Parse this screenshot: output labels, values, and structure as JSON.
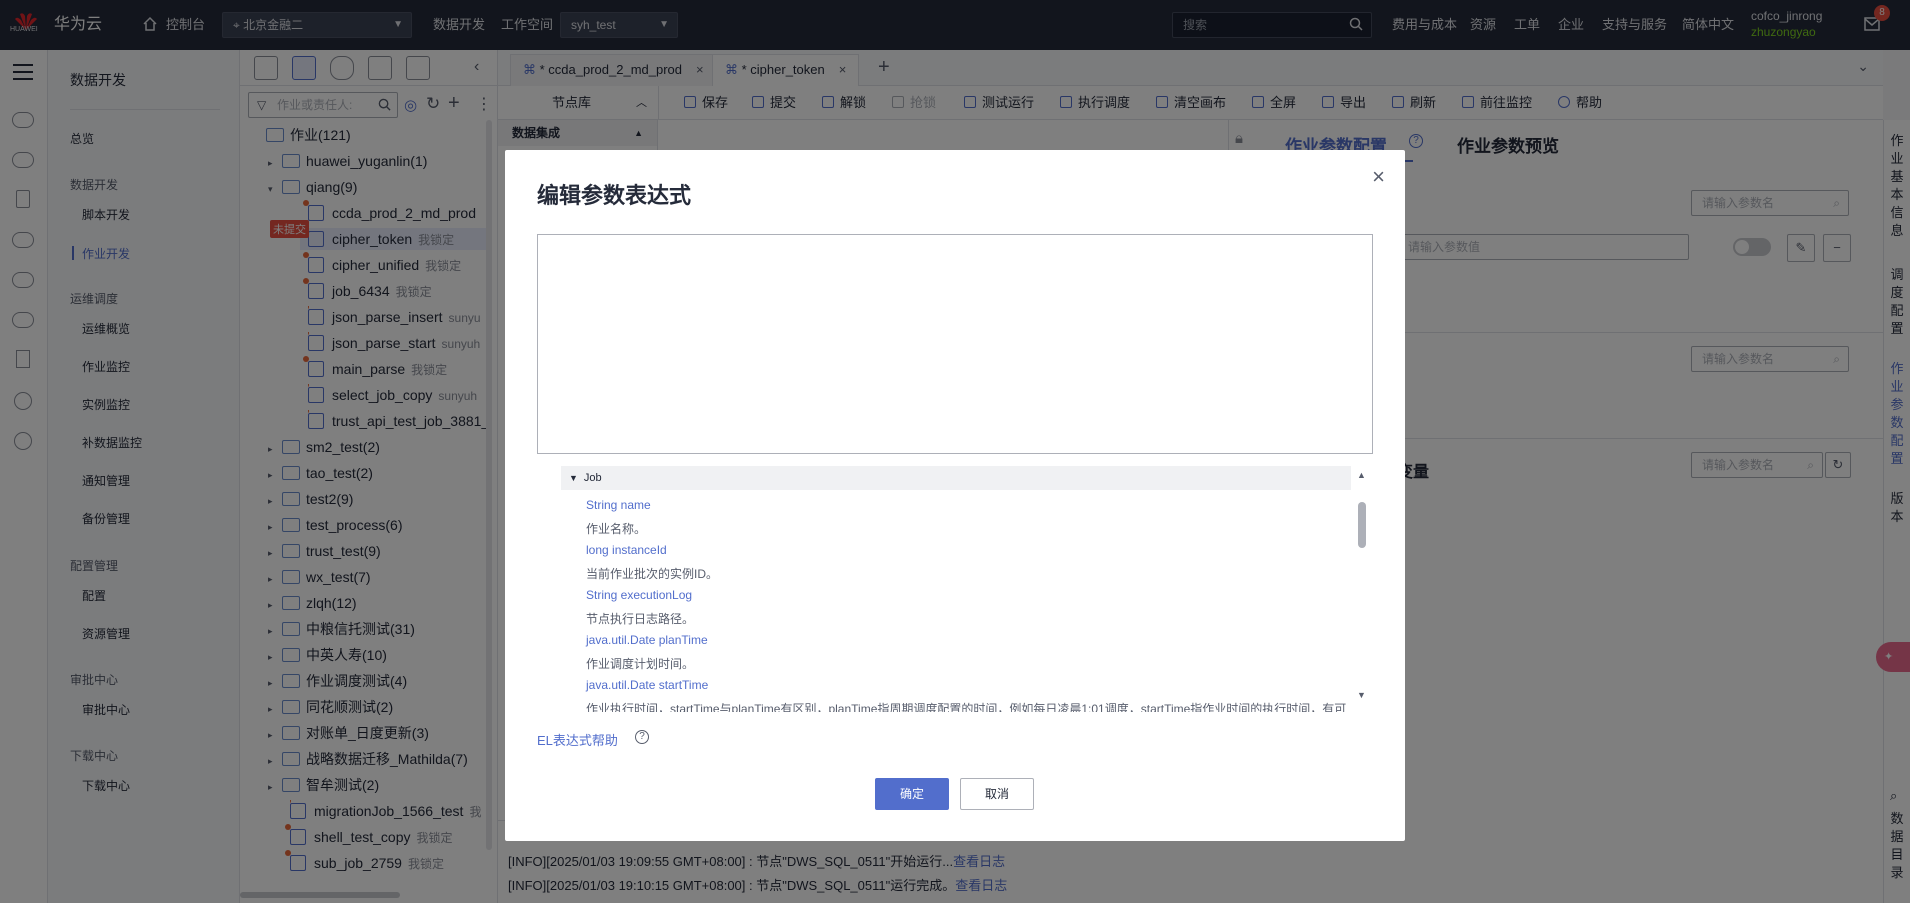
{
  "topbar": {
    "brand": "华为云",
    "brand_sub": "HUAWEI",
    "console": "控制台",
    "region": "北京金融二",
    "data_dev": "数据开发",
    "workspace_label": "工作空间",
    "workspace_value": "syh_test",
    "search_placeholder": "搜索",
    "links": [
      "费用与成本",
      "资源",
      "工单",
      "企业",
      "支持与服务",
      "简体中文"
    ],
    "user_line1": "cofco_jinrong",
    "user_line2": "zhuzongyao",
    "notif_count": "8"
  },
  "nav": {
    "title": "数据开发",
    "overview": "总览",
    "sec_dev": "数据开发",
    "script_dev": "脚本开发",
    "job_dev": "作业开发",
    "sec_ops": "运维调度",
    "ops_overview": "运维概览",
    "job_monitor": "作业监控",
    "instance_monitor": "实例监控",
    "backfill_monitor": "补数据监控",
    "notify_mgmt": "通知管理",
    "backup_mgmt": "备份管理",
    "sec_config": "配置管理",
    "config": "配置",
    "resource_mgmt": "资源管理",
    "sec_approval": "审批中心",
    "approval_center": "审批中心",
    "sec_download": "下载中心",
    "download_center": "下载中心"
  },
  "tree": {
    "search_placeholder": "作业或责任人:",
    "unsubmitted_tag": "未提交",
    "root": "作业(121)",
    "rows": [
      {
        "label": "huawei_yuganlin(1)",
        "meta": ""
      },
      {
        "label": "qiang(9)",
        "meta": ""
      },
      {
        "label": "ccda_prod_2_md_prod",
        "meta": ""
      },
      {
        "label": "cipher_token",
        "meta": "我锁定"
      },
      {
        "label": "cipher_unified",
        "meta": "我锁定"
      },
      {
        "label": "job_6434",
        "meta": "我锁定"
      },
      {
        "label": "json_parse_insert",
        "meta": "sunyu"
      },
      {
        "label": "json_parse_start",
        "meta": "sunyuh"
      },
      {
        "label": "main_parse",
        "meta": "我锁定"
      },
      {
        "label": "select_job_copy",
        "meta": "sunyuh"
      },
      {
        "label": "trust_api_test_job_3881_",
        "meta": ""
      },
      {
        "label": "sm2_test(2)",
        "meta": ""
      },
      {
        "label": "tao_test(2)",
        "meta": ""
      },
      {
        "label": "test2(9)",
        "meta": ""
      },
      {
        "label": "test_process(6)",
        "meta": ""
      },
      {
        "label": "trust_test(9)",
        "meta": ""
      },
      {
        "label": "wx_test(7)",
        "meta": ""
      },
      {
        "label": "zlqh(12)",
        "meta": ""
      },
      {
        "label": "中粮信托测试(31)",
        "meta": ""
      },
      {
        "label": "中英人寿(10)",
        "meta": ""
      },
      {
        "label": "作业调度测试(4)",
        "meta": ""
      },
      {
        "label": "同花顺测试(2)",
        "meta": ""
      },
      {
        "label": "对账单_日度更新(3)",
        "meta": ""
      },
      {
        "label": "战略数据迁移_Mathilda(7)",
        "meta": ""
      },
      {
        "label": "智牟测试(2)",
        "meta": ""
      },
      {
        "label": "migrationJob_1566_test",
        "meta": "我"
      },
      {
        "label": "shell_test_copy",
        "meta": "我锁定"
      },
      {
        "label": "sub_job_2759",
        "meta": "我锁定"
      }
    ]
  },
  "tabs": {
    "tab1": "* ccda_prod_2_md_prod",
    "tab2": "* cipher_token",
    "add": "+"
  },
  "toolbar": {
    "node_lib": "节点库",
    "save": "保存",
    "submit": "提交",
    "unlock": "解锁",
    "grab_lock": "抢锁",
    "test_run": "测试运行",
    "exec_schedule": "执行调度",
    "clear_canvas": "清空画布",
    "fullscreen": "全屏",
    "export": "导出",
    "refresh": "刷新",
    "goto_monitor": "前往监控",
    "help": "帮助"
  },
  "nodelib": {
    "group": "数据集成"
  },
  "right": {
    "tab_config": "作业参数配置",
    "tab_preview": "作业参数预览",
    "param_name_placeholder": "请输入参数名",
    "param_value_placeholder": "请输入参数值",
    "variables": "变量"
  },
  "vtabs": {
    "basic": "作业基本信息",
    "schedule": "调度配置",
    "params": "作业参数配置",
    "version": "版本",
    "catalog": "数据目录"
  },
  "log": {
    "line1_text": "[INFO][2025/01/03 19:09:55 GMT+08:00] : 节点\"DWS_SQL_0511\"开始运行...",
    "line1_link": "查看日志",
    "line2_text": "[INFO][2025/01/03 19:10:15 GMT+08:00] : 节点\"DWS_SQL_0511\"运行完成。",
    "line2_link": "查看日志"
  },
  "modal": {
    "title": "编辑参数表达式",
    "close": "×",
    "ref_group": "Job",
    "ref_items": [
      {
        "sig": "String name",
        "desc": "作业名称。"
      },
      {
        "sig": "long instanceId",
        "desc": "当前作业批次的实例ID。"
      },
      {
        "sig": "String executionLog",
        "desc": "节点执行日志路径。"
      },
      {
        "sig": "java.util.Date planTime",
        "desc": "作业调度计划时间。"
      },
      {
        "sig": "java.util.Date startTime",
        "desc": "作业执行时间，startTime与planTime有区别，planTime指周期调度配置的时间，例如每日凌晨1:01调度，startTime指作业时间的执行时间，有可"
      }
    ],
    "el_help": "EL表达式帮助",
    "help_q": "?",
    "confirm": "确定",
    "cancel": "取消"
  }
}
